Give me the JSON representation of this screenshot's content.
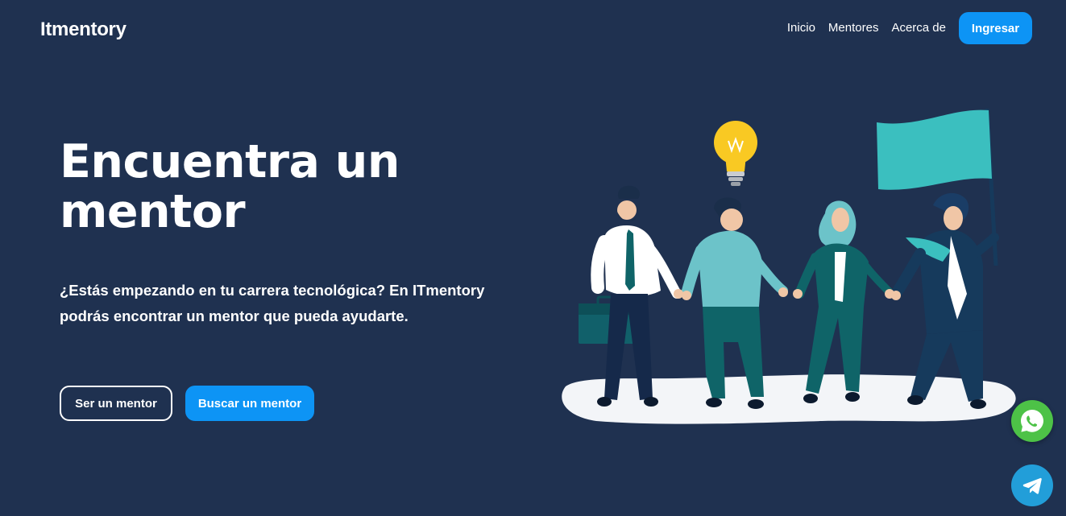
{
  "nav": {
    "brand": "Itmentory",
    "links": [
      "Inicio",
      "Mentores",
      "Acerca de"
    ],
    "login_label": "Ingresar"
  },
  "hero": {
    "title": "Encuentra un mentor",
    "text": "¿Estás empezando en tu carrera tecnológica? En ITmentory podrás encontrar un mentor que pueda ayudarte.",
    "btn_become": "Ser un mentor",
    "btn_search": "Buscar un mentor"
  },
  "floating": {
    "whatsapp_icon": "whatsapp-icon",
    "telegram_icon": "telegram-icon"
  },
  "colors": {
    "background": "#1f3150",
    "accent": "#0d94f5",
    "whatsapp": "#4dc247",
    "telegram": "#229ed9"
  }
}
